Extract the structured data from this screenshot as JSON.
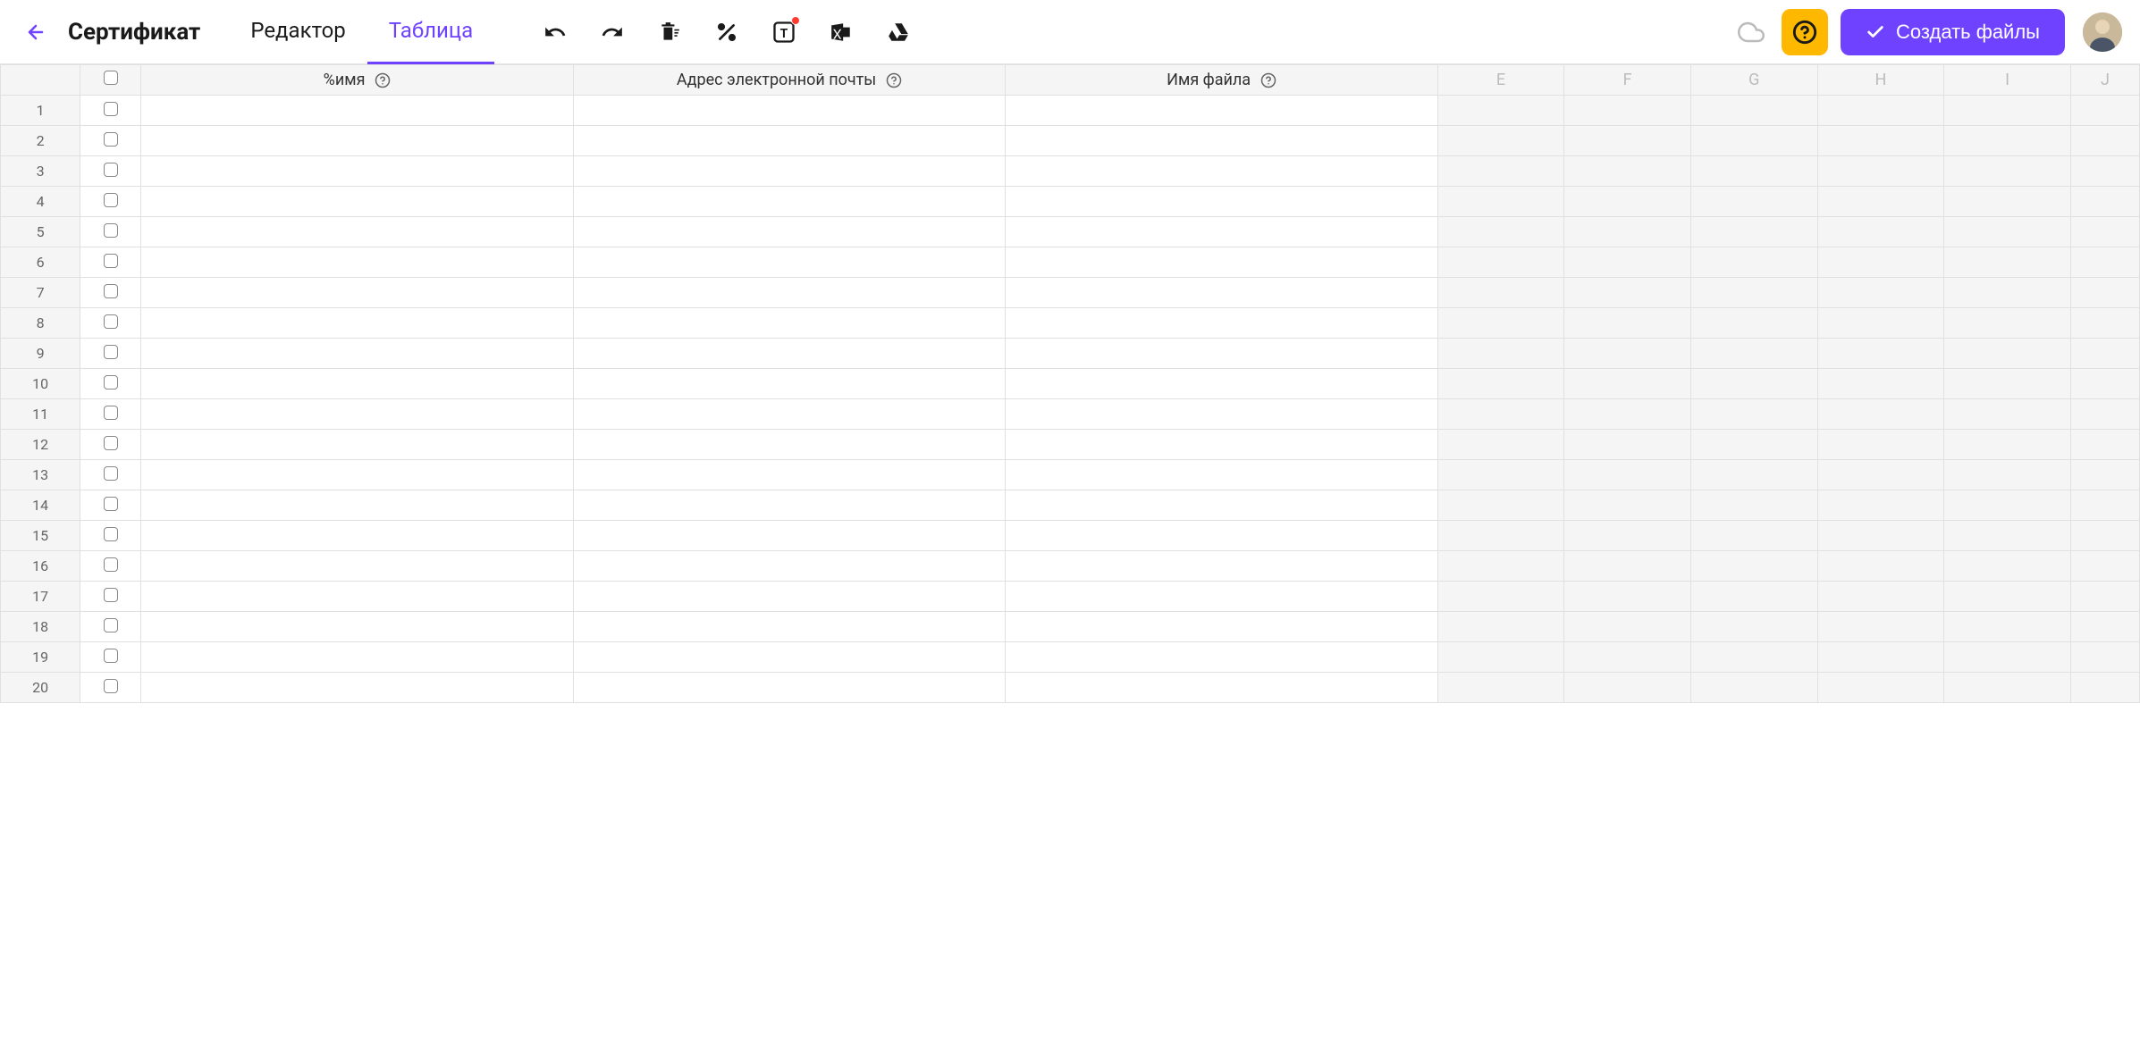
{
  "header": {
    "title": "Сертификат",
    "tabs": [
      {
        "label": "Редактор",
        "active": false
      },
      {
        "label": "Таблица",
        "active": true
      }
    ],
    "create_button_label": "Создать файлы"
  },
  "columns": {
    "named": [
      {
        "label": "%имя"
      },
      {
        "label": "Адрес электронной почты"
      },
      {
        "label": "Имя файла"
      }
    ],
    "extra": [
      "E",
      "F",
      "G",
      "H",
      "I",
      "J"
    ]
  },
  "row_count": 20,
  "icons": {
    "back": "arrow-left",
    "undo": "undo",
    "redo": "redo",
    "delete": "trash",
    "percent": "percent",
    "text": "text-box",
    "excel": "excel",
    "drive": "google-drive",
    "cloud": "cloud",
    "help": "help-circle",
    "check": "check"
  },
  "colors": {
    "accent": "#6F42FF",
    "warning": "#FFB800"
  }
}
